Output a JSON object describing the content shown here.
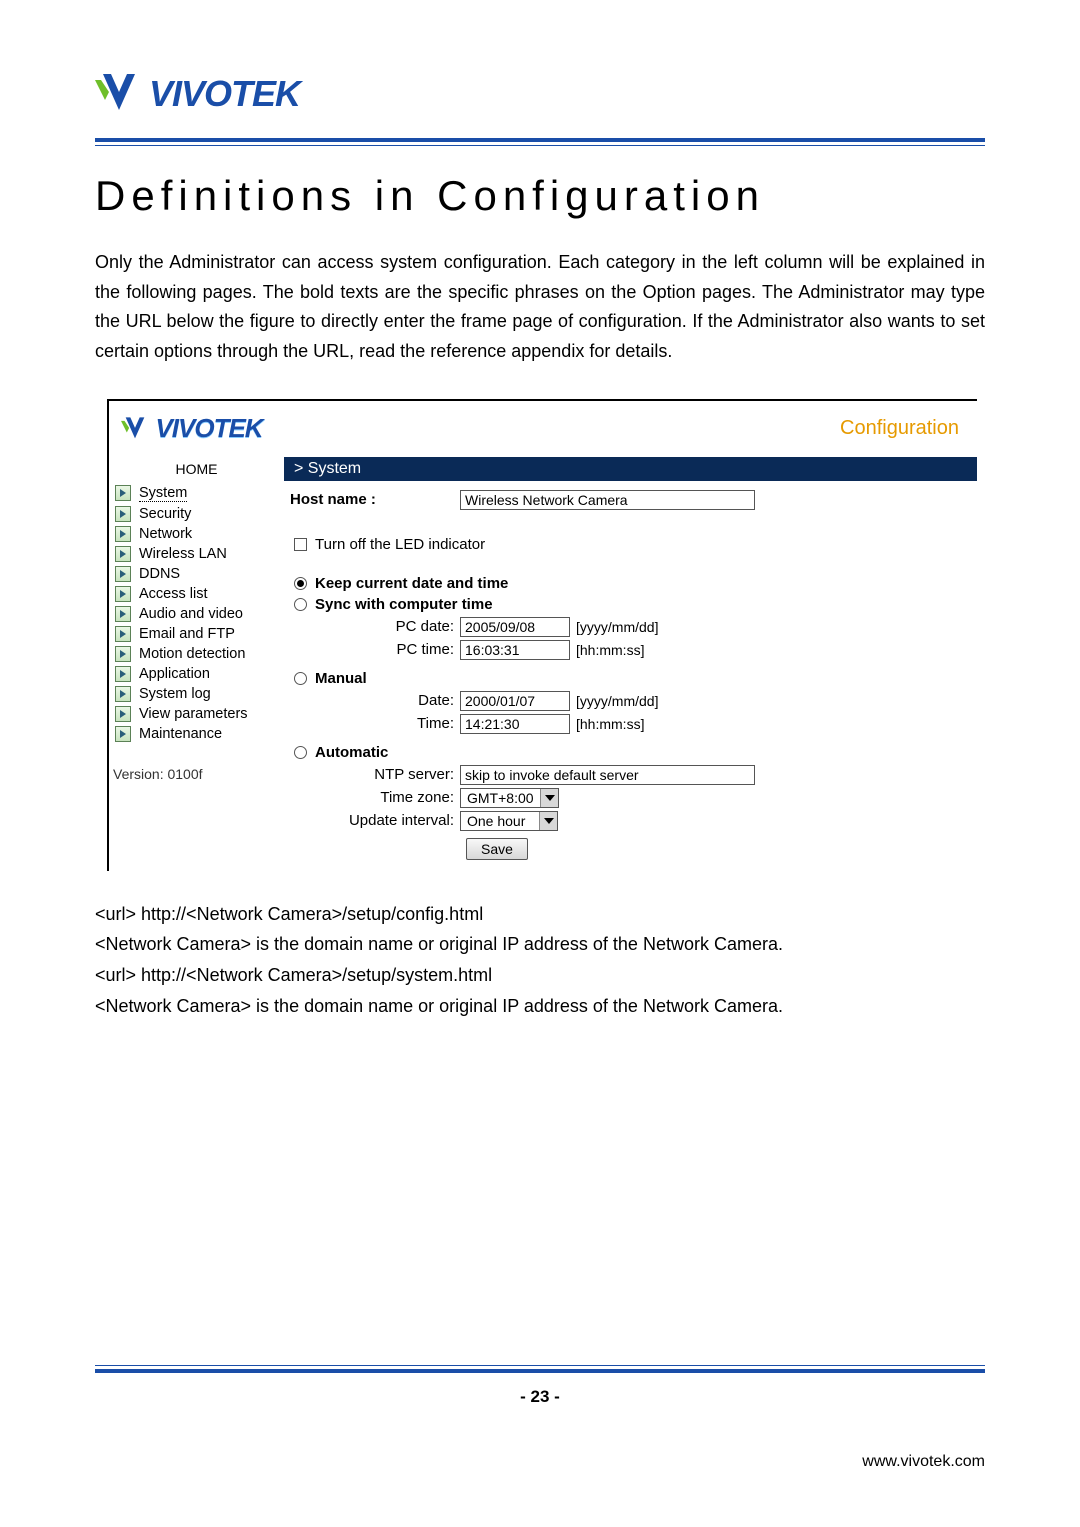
{
  "header": {
    "logo_text": "VIVOTEK"
  },
  "title": "Definitions in Configuration",
  "intro": "Only the Administrator can access system configuration. Each category in the left column will be explained in the following pages. The bold texts are the specific phrases on the Option pages. The Administrator may type the URL below the figure to directly enter the frame page of configuration. If the Administrator also wants to set certain options through the URL, read the reference appendix for details.",
  "screenshot": {
    "logo_text": "VIVOTEK",
    "config_label": "Configuration",
    "home": "HOME",
    "nav": [
      "System",
      "Security",
      "Network",
      "Wireless LAN",
      "DDNS",
      "Access list",
      "Audio and video",
      "Email and FTP",
      "Motion detection",
      "Application",
      "System log",
      "View parameters",
      "Maintenance"
    ],
    "version": "Version: 0100f",
    "section_title": "> System",
    "hostname_label": "Host name :",
    "hostname_value": "Wireless Network Camera",
    "led_label": "Turn off the LED indicator",
    "radios": {
      "keep": "Keep current date and time",
      "sync": "Sync with computer time",
      "manual": "Manual",
      "automatic": "Automatic"
    },
    "sync": {
      "pcdate_label": "PC date:",
      "pcdate_value": "2005/09/08",
      "pcdate_hint": "[yyyy/mm/dd]",
      "pctime_label": "PC time:",
      "pctime_value": "16:03:31",
      "pctime_hint": "[hh:mm:ss]"
    },
    "manual": {
      "date_label": "Date:",
      "date_value": "2000/01/07",
      "date_hint": "[yyyy/mm/dd]",
      "time_label": "Time:",
      "time_value": "14:21:30",
      "time_hint": "[hh:mm:ss]"
    },
    "auto": {
      "ntp_label": "NTP server:",
      "ntp_value": "skip to invoke default server",
      "tz_label": "Time zone:",
      "tz_value": "GMT+8:00",
      "upd_label": "Update interval:",
      "upd_value": "One hour"
    },
    "save": "Save"
  },
  "notes": [
    "<url> http://<Network Camera>/setup/config.html",
    "<Network Camera> is the domain name or original IP address of the Network Camera.",
    "<url> http://<Network Camera>/setup/system.html",
    "<Network Camera> is the domain name or original IP address of the Network Camera."
  ],
  "page_number": "- 23 -",
  "site": "www.vivotek.com"
}
